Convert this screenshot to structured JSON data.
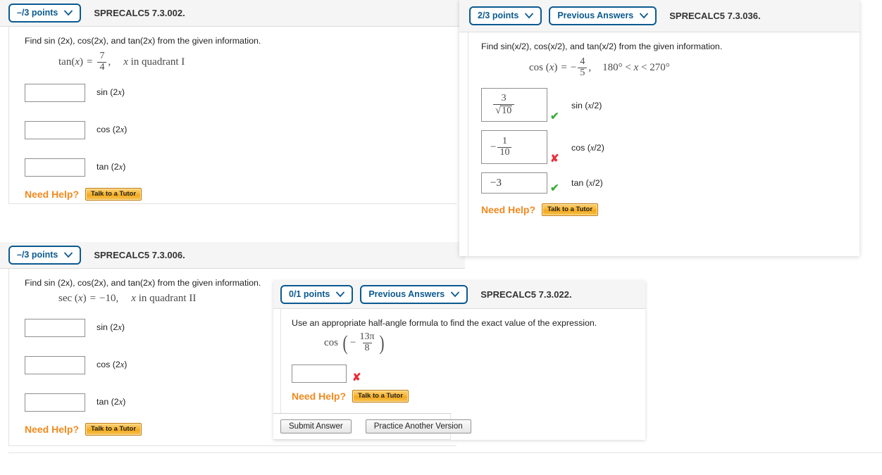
{
  "questions": [
    {
      "id": "sprecalc5-7-3-002",
      "points_label": "–/3 points",
      "has_previous_answers": false,
      "previous_answers_label": "",
      "code": "SPRECALC5 7.3.002.",
      "prompt_prefix": "Find sin (2",
      "prompt": "Find sin (2x), cos(2x), and tan(2x) from the given information.",
      "given": {
        "func": "tan",
        "arg": "x",
        "numerator": "7",
        "denominator": "4",
        "condition": "x in quadrant I"
      },
      "answers": [
        {
          "value": "",
          "label": "sin (2x)",
          "status": "none"
        },
        {
          "value": "",
          "label": "cos (2x)",
          "status": "none"
        },
        {
          "value": "",
          "label": "tan (2x)",
          "status": "none"
        }
      ],
      "need_help_label": "Need Help?",
      "tutor_button_label": "Talk to a Tutor"
    },
    {
      "id": "sprecalc5-7-3-036",
      "points_label": "2/3 points",
      "has_previous_answers": true,
      "previous_answers_label": "Previous Answers",
      "code": "SPRECALC5 7.3.036.",
      "prompt": "Find sin(x/2), cos(x/2), and tan(x/2) from the given information.",
      "given": {
        "func": "cos",
        "arg": "x",
        "numerator": "4",
        "denominator": "5",
        "sign": "−",
        "condition": "180° < x < 270°"
      },
      "answers": [
        {
          "value": "3 / √10",
          "label": "sin (x/2)",
          "status": "correct"
        },
        {
          "value": "− 1 / 10",
          "label": "cos (x/2)",
          "status": "incorrect"
        },
        {
          "value": "−3",
          "label": "tan (x/2)",
          "status": "correct"
        }
      ],
      "need_help_label": "Need Help?",
      "tutor_button_label": "Talk to a Tutor"
    },
    {
      "id": "sprecalc5-7-3-006",
      "points_label": "–/3 points",
      "has_previous_answers": false,
      "previous_answers_label": "",
      "code": "SPRECALC5 7.3.006.",
      "prompt": "Find sin (2x), cos(2x), and tan(2x) from the given information.",
      "given": {
        "func": "sec",
        "arg": "x",
        "value": "−10",
        "condition": "x in quadrant II"
      },
      "answers": [
        {
          "value": "",
          "label": "sin (2x)",
          "status": "none"
        },
        {
          "value": "",
          "label": "cos (2x)",
          "status": "none"
        },
        {
          "value": "",
          "label": "tan (2x)",
          "status": "none"
        }
      ],
      "need_help_label": "Need Help?",
      "tutor_button_label": "Talk to a Tutor"
    },
    {
      "id": "sprecalc5-7-3-022",
      "points_label": "0/1 points",
      "has_previous_answers": true,
      "previous_answers_label": "Previous Answers",
      "code": "SPRECALC5 7.3.022.",
      "prompt": "Use an appropriate half-angle formula to find the exact value of the expression.",
      "given": {
        "func": "cos",
        "numerator": "13π",
        "denominator": "8",
        "sign": "−"
      },
      "answers": [
        {
          "value": "",
          "label": "",
          "status": "incorrect"
        }
      ],
      "need_help_label": "Need Help?",
      "tutor_button_label": "Talk to a Tutor",
      "footer": {
        "submit_label": "Submit Answer",
        "practice_label": "Practice Another Version"
      }
    }
  ],
  "marks": {
    "correct_glyph": "✔",
    "incorrect_glyph": "✘",
    "correct_color": "#3fae3f",
    "incorrect_color": "#e8303a"
  },
  "theme": {
    "pill_border": "#0b5a90",
    "pill_text": "#0b5a90",
    "header_bg": "#f5f5f5",
    "need_help_color": "#f08a1e",
    "tutor_bg": "#f8b733"
  }
}
